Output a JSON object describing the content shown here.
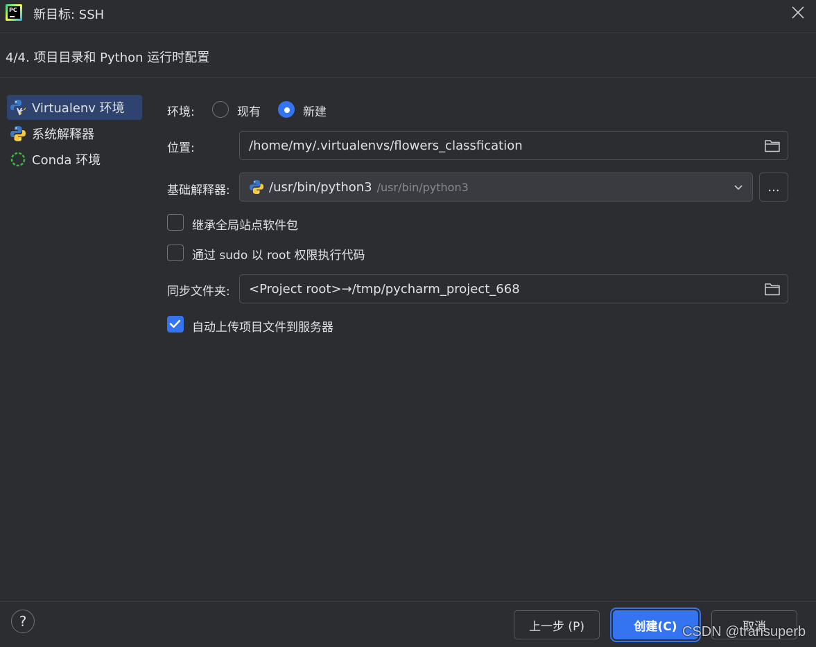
{
  "window": {
    "title": "新目标: SSH",
    "step": "4/4. 项目目录和 Python 运行时配置"
  },
  "sidebar": {
    "items": [
      {
        "label": "Virtualenv 环境",
        "icon": "virtualenv-icon",
        "selected": true
      },
      {
        "label": "系统解释器",
        "icon": "python-icon",
        "selected": false
      },
      {
        "label": "Conda 环境",
        "icon": "conda-icon",
        "selected": false
      }
    ]
  },
  "form": {
    "env_label": "环境:",
    "env_options": [
      "现有",
      "新建"
    ],
    "env_selected": "新建",
    "location_label": "位置:",
    "location_value": "/home/my/.virtualenvs/flowers_classfication",
    "base_interpreter_label": "基础解释器:",
    "base_interpreter_value": "/usr/bin/python3",
    "base_interpreter_hint": "/usr/bin/python3",
    "browse_label": "...",
    "inherit_label": "继承全局站点软件包",
    "inherit_checked": false,
    "sudo_label": "通过 sudo 以 root 权限执行代码",
    "sudo_checked": false,
    "sync_label": "同步文件夹:",
    "sync_value": "<Project root>→/tmp/pycharm_project_668",
    "autoupload_label": "自动上传项目文件到服务器",
    "autoupload_checked": true
  },
  "footer": {
    "help": "?",
    "prev_label": "上一步 (P)",
    "create_label": "创建(C)",
    "cancel_label": "取消"
  },
  "watermark": "CSDN @transuperb",
  "colors": {
    "background": "#2b2d30",
    "accent": "#3574f0",
    "selection": "#2e436e",
    "text": "#dfe1e5"
  }
}
